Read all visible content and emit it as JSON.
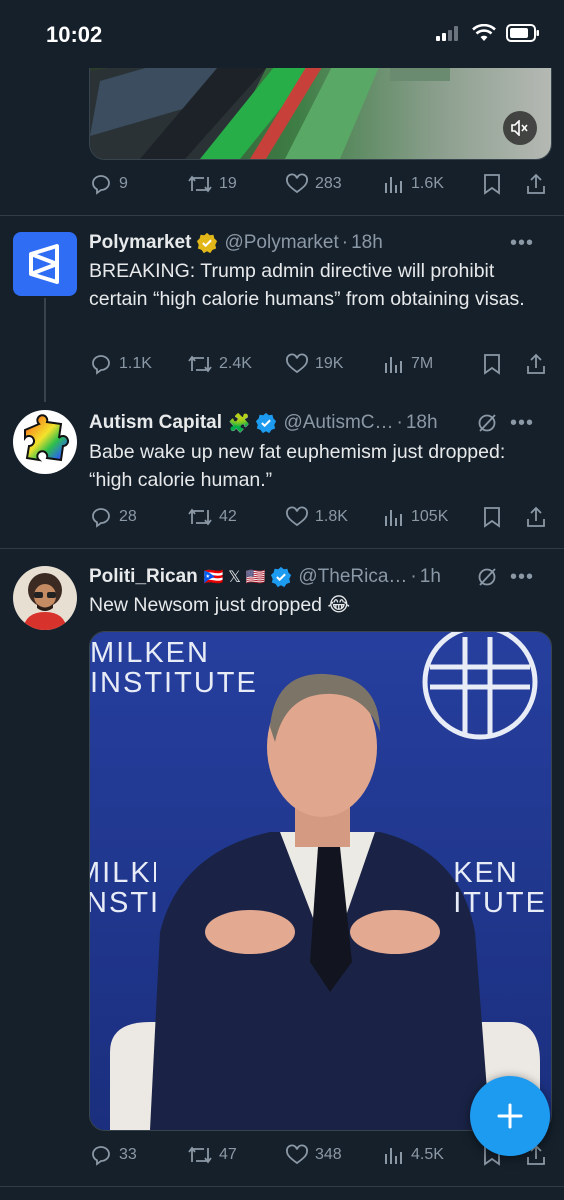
{
  "status_bar": {
    "time": "10:02"
  },
  "tweet0": {
    "stats": {
      "replies": "9",
      "reposts": "19",
      "likes": "283",
      "views": "1.6K"
    }
  },
  "tweet1": {
    "name": "Polymarket",
    "handle": "@Polymarket",
    "time": "18h",
    "text": "BREAKING: Trump admin directive will prohibit certain “high calorie humans” from obtaining visas.",
    "stats": {
      "replies": "1.1K",
      "reposts": "2.4K",
      "likes": "19K",
      "views": "7M"
    }
  },
  "tweet2": {
    "name": "Autism Capital",
    "name_emoji": "🧩",
    "handle": "@AutismC…",
    "time": "18h",
    "text": "Babe wake up new fat euphemism just dropped: “high calorie human.”",
    "stats": {
      "replies": "28",
      "reposts": "42",
      "likes": "1.8K",
      "views": "105K"
    }
  },
  "tweet3": {
    "name": "Politi_Rican",
    "name_flags": "🇵🇷 𝕏 🇺🇸",
    "handle": "@TheRica…",
    "time": "1h",
    "text": "New Newsom just dropped 😂",
    "media": {
      "sign_top_line1": "MILKEN",
      "sign_top_line2": "INSTITUTE",
      "sign_left_line1": "MILKEN",
      "sign_left_line2": "INSTITUTE",
      "sign_right_line1": "KEN",
      "sign_right_line2": "ITUTE"
    },
    "stats": {
      "replies": "33",
      "reposts": "47",
      "likes": "348",
      "views": "4.5K"
    }
  },
  "icons": {
    "reply": "reply-icon",
    "repost": "repost-icon",
    "like": "heart-icon",
    "views": "views-icon",
    "bookmark": "bookmark-icon",
    "share": "share-icon",
    "verified": "verified-badge-icon",
    "muted": "speaker-muted-icon",
    "compose": "compose-plus-icon",
    "grok": "grok-icon",
    "more": "more-icon"
  },
  "colors": {
    "background": "#15202b",
    "accent": "#1d9bf0",
    "gold_badge": "#e2b719",
    "muted_text": "#8b98a5"
  }
}
